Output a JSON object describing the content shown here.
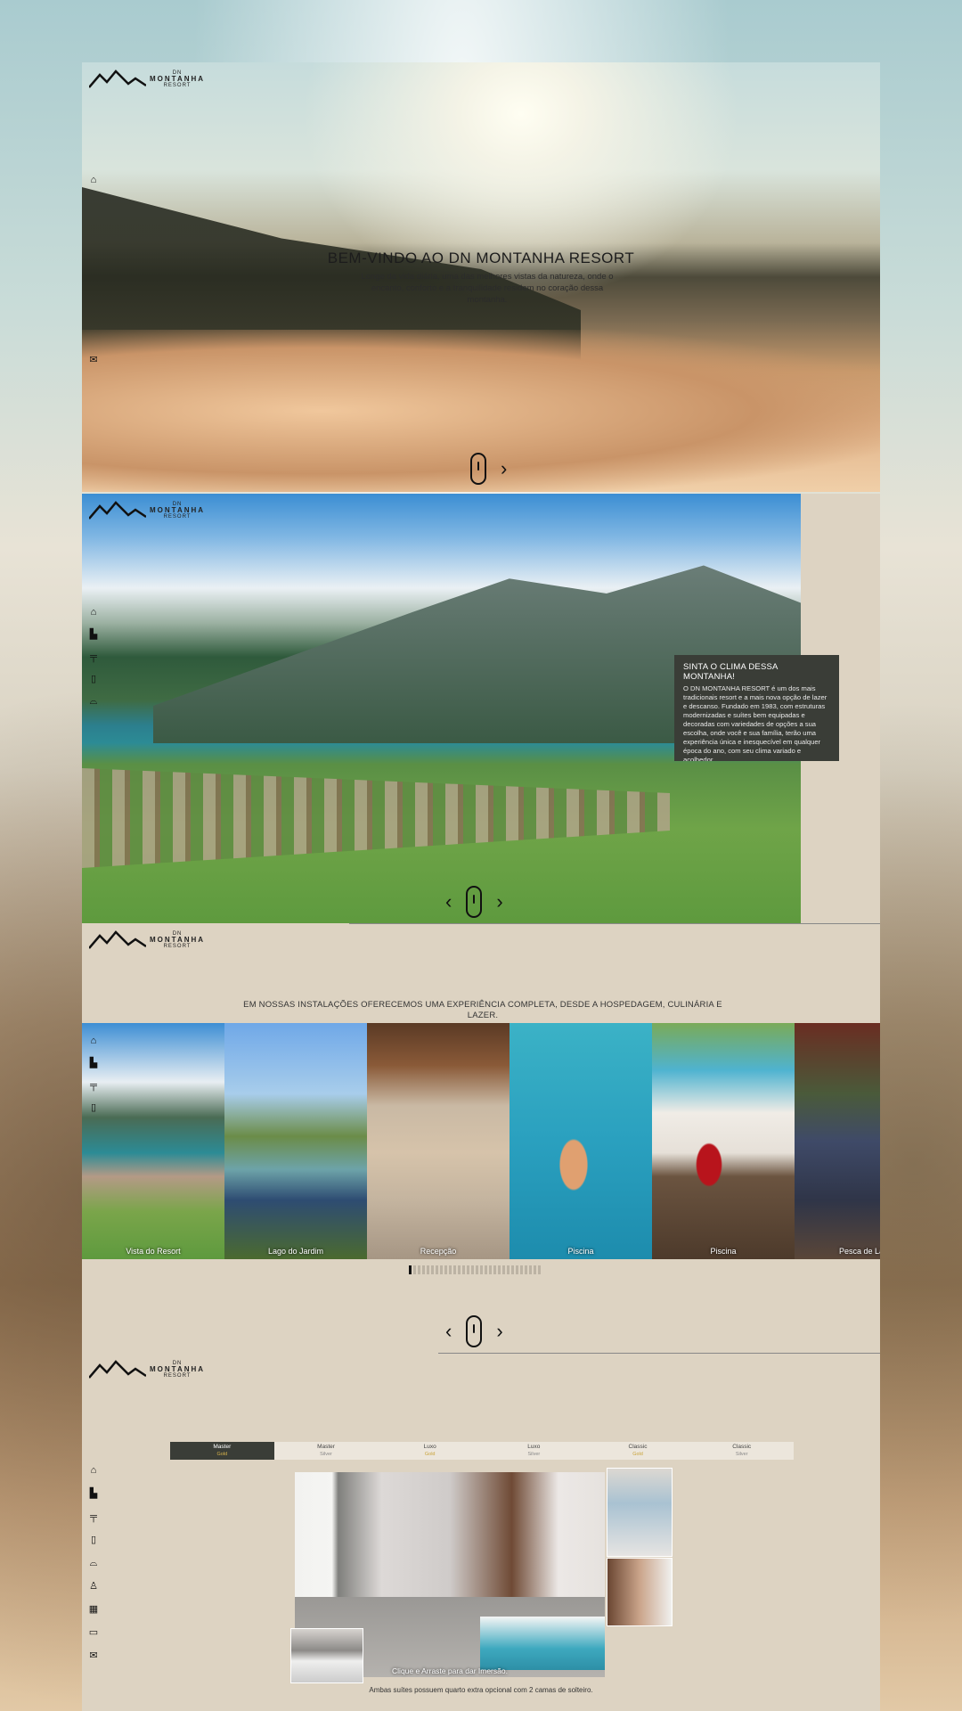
{
  "brand": {
    "line1": "DN",
    "line2": "MONTANHA",
    "line3": "RESORT"
  },
  "nav_icons": [
    "home-icon",
    "hotel-icon",
    "dining-icon",
    "door-icon",
    "bell-icon",
    "hiking-icon",
    "services-icon",
    "book-icon",
    "mail-icon"
  ],
  "hero": {
    "title": "BEM-VINDO AO DN MONTANHA RESORT",
    "subtitle": "Longe da vida diária, uma das melhores vistas da natureza, onde o encanto, conforto e a tranquilidade residem no coração dessa montanha."
  },
  "about": {
    "title": "SINTA O CLIMA DESSA MONTANHA!",
    "text": "O DN MONTANHA RESORT é um dos mais tradicionais resort e a mais nova opção de lazer e descanso. Fundado em 1983, com estruturas modernizadas e suítes bem equipadas e decoradas com variedades de opções a sua escolha, onde você e sua família, terão uma experiência única e inesquecível em qualquer época do ano, com seu clima variado e acolhedor."
  },
  "facilities": {
    "title": "EM NOSSAS INSTALAÇÕES OFERECEMOS UMA EXPERIÊNCIA COMPLETA, DESDE A HOSPEDAGEM, CULINÁRIA E LAZER.",
    "cards": [
      {
        "label": "Vista do Resort"
      },
      {
        "label": "Lago do Jardim"
      },
      {
        "label": "Recepção"
      },
      {
        "label": "Piscina"
      },
      {
        "label": "Piscina"
      },
      {
        "label": "Pesca de Lago"
      }
    ],
    "pager_total": 30,
    "pager_active": 1
  },
  "rooms": {
    "tabs": [
      {
        "name": "Master",
        "tier": "Gold",
        "active": true
      },
      {
        "name": "Master",
        "tier": "Silver",
        "active": false
      },
      {
        "name": "Luxo",
        "tier": "Gold",
        "active": false
      },
      {
        "name": "Luxo",
        "tier": "Silver",
        "active": false
      },
      {
        "name": "Classic",
        "tier": "Gold",
        "active": false
      },
      {
        "name": "Classic",
        "tier": "Silver",
        "active": false
      }
    ],
    "image_caption": "Clique e Arraste para dar Imersão.",
    "note": "Ambas suítes possuem quarto extra opcional com 2 camas de solteiro."
  },
  "colors": {
    "panel_dark": "#3a3d37",
    "page_beige": "#ddd3c2",
    "gold": "#c9a33a"
  }
}
